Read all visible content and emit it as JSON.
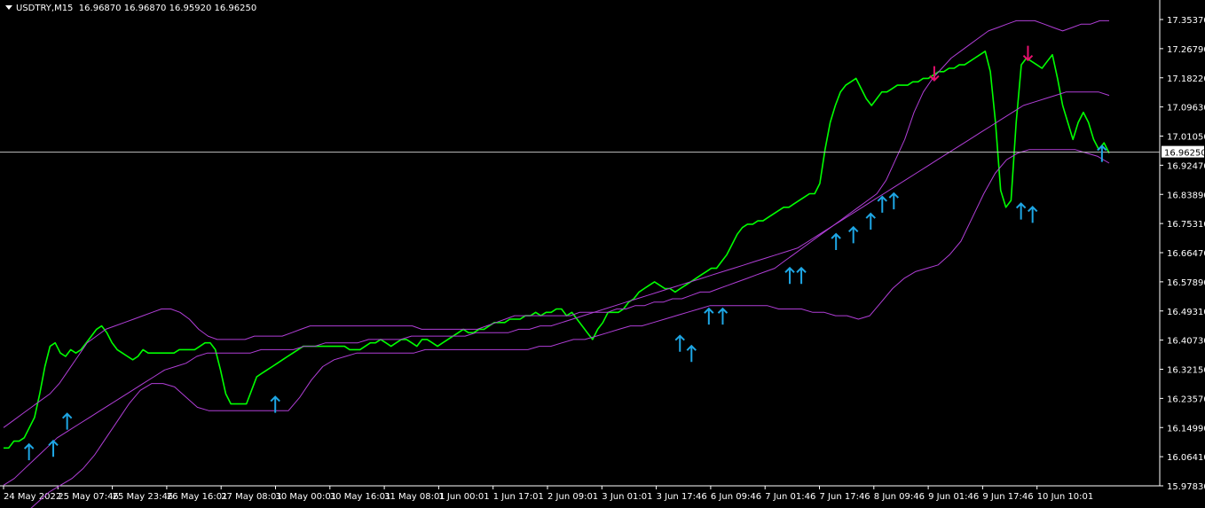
{
  "header": {
    "symbol_tf": "USDTRY,M15",
    "open": "16.96870",
    "high": "16.96870",
    "low": "16.95920",
    "close": "16.96250"
  },
  "chart_data": {
    "type": "line",
    "symbol": "USDTRY",
    "timeframe": "M15",
    "current_price": "16.96250",
    "y_axis_labels": [
      "17.35370",
      "17.26790",
      "17.18220",
      "17.09630",
      "17.01050",
      "16.92470",
      "16.83890",
      "16.75310",
      "16.66470",
      "16.57890",
      "16.49310",
      "16.40730",
      "16.32150",
      "16.23570",
      "16.14990",
      "16.06410",
      "15.97830"
    ],
    "y_range": [
      15.9783,
      17.3537
    ],
    "x_axis_labels": [
      "24 May 2022",
      "25 May 07:46",
      "25 May 23:46",
      "26 May 16:01",
      "27 May 08:01",
      "30 May 00:01",
      "30 May 16:01",
      "31 May 08:01",
      "1 Jun 00:01",
      "1 Jun 17:01",
      "2 Jun 09:01",
      "3 Jun 01:01",
      "3 Jun 17:46",
      "6 Jun 09:46",
      "7 Jun 01:46",
      "7 Jun 17:46",
      "8 Jun 09:46",
      "9 Jun 01:46",
      "9 Jun 17:46",
      "10 Jun 10:01"
    ],
    "series": [
      {
        "role": "price",
        "values": [
          16.09,
          16.09,
          16.11,
          16.11,
          16.12,
          16.15,
          16.18,
          16.25,
          16.33,
          16.39,
          16.4,
          16.37,
          16.36,
          16.38,
          16.37,
          16.38,
          16.4,
          16.42,
          16.44,
          16.45,
          16.43,
          16.4,
          16.38,
          16.37,
          16.36,
          16.35,
          16.36,
          16.38,
          16.37,
          16.37,
          16.37,
          16.37,
          16.37,
          16.37,
          16.38,
          16.38,
          16.38,
          16.38,
          16.39,
          16.4,
          16.4,
          16.38,
          16.32,
          16.25,
          16.22,
          16.22,
          16.22,
          16.22,
          16.26,
          16.3,
          16.31,
          16.32,
          16.33,
          16.34,
          16.35,
          16.36,
          16.37,
          16.38,
          16.39,
          16.39,
          16.39,
          16.39,
          16.39,
          16.39,
          16.39,
          16.39,
          16.39,
          16.38,
          16.38,
          16.38,
          16.39,
          16.4,
          16.4,
          16.41,
          16.4,
          16.39,
          16.4,
          16.41,
          16.41,
          16.4,
          16.39,
          16.41,
          16.41,
          16.4,
          16.39,
          16.4,
          16.41,
          16.42,
          16.43,
          16.44,
          16.43,
          16.43,
          16.44,
          16.44,
          16.45,
          16.46,
          16.46,
          16.46,
          16.47,
          16.47,
          16.47,
          16.48,
          16.48,
          16.49,
          16.48,
          16.49,
          16.49,
          16.5,
          16.5,
          16.48,
          16.49,
          16.47,
          16.45,
          16.43,
          16.41,
          16.44,
          16.46,
          16.49,
          16.49,
          16.49,
          16.5,
          16.52,
          16.53,
          16.55,
          16.56,
          16.57,
          16.58,
          16.57,
          16.56,
          16.56,
          16.55,
          16.56,
          16.57,
          16.58,
          16.59,
          16.6,
          16.61,
          16.62,
          16.62,
          16.64,
          16.66,
          16.69,
          16.72,
          16.74,
          16.75,
          16.75,
          16.76,
          16.76,
          16.77,
          16.78,
          16.79,
          16.8,
          16.8,
          16.81,
          16.82,
          16.83,
          16.84,
          16.84,
          16.87,
          16.97,
          17.05,
          17.1,
          17.14,
          17.16,
          17.17,
          17.18,
          17.15,
          17.12,
          17.1,
          17.12,
          17.14,
          17.14,
          17.15,
          17.16,
          17.16,
          17.16,
          17.17,
          17.17,
          17.18,
          17.18,
          17.19,
          17.2,
          17.2,
          17.21,
          17.21,
          17.22,
          17.22,
          17.23,
          17.24,
          17.25,
          17.26,
          17.2,
          17.05,
          16.85,
          16.8,
          16.82,
          17.05,
          17.22,
          17.24,
          17.23,
          17.22,
          17.21,
          17.23,
          17.25,
          17.18,
          17.1,
          17.05,
          17.0,
          17.05,
          17.08,
          17.05,
          17.0,
          16.97,
          16.99,
          16.96
        ],
        "color": "#00ff00"
      },
      {
        "role": "upper_band",
        "values": [
          16.15,
          16.17,
          16.19,
          16.21,
          16.23,
          16.25,
          16.28,
          16.32,
          16.36,
          16.4,
          16.42,
          16.44,
          16.45,
          16.46,
          16.47,
          16.48,
          16.49,
          16.5,
          16.5,
          16.49,
          16.47,
          16.44,
          16.42,
          16.41,
          16.41,
          16.41,
          16.41,
          16.42,
          16.42,
          16.42,
          16.42,
          16.43,
          16.44,
          16.45,
          16.45,
          16.45,
          16.45,
          16.45,
          16.45,
          16.45,
          16.45,
          16.45,
          16.45,
          16.45,
          16.45,
          16.44,
          16.44,
          16.44,
          16.44,
          16.44,
          16.44,
          16.44,
          16.45,
          16.46,
          16.47,
          16.48,
          16.48,
          16.48,
          16.48,
          16.48,
          16.48,
          16.48,
          16.49,
          16.49,
          16.49,
          16.49,
          16.5,
          16.5,
          16.51,
          16.51,
          16.52,
          16.52,
          16.53,
          16.53,
          16.54,
          16.55,
          16.55,
          16.56,
          16.57,
          16.58,
          16.59,
          16.6,
          16.61,
          16.62,
          16.64,
          16.66,
          16.68,
          16.7,
          16.72,
          16.74,
          16.76,
          16.78,
          16.8,
          16.82,
          16.84,
          16.88,
          16.94,
          17.0,
          17.08,
          17.14,
          17.18,
          17.21,
          17.24,
          17.26,
          17.28,
          17.3,
          17.32,
          17.33,
          17.34,
          17.35,
          17.35,
          17.35,
          17.34,
          17.33,
          17.32,
          17.33,
          17.34,
          17.34,
          17.35,
          17.35
        ],
        "color": "#b03ed6"
      },
      {
        "role": "middle_band",
        "values": [
          15.98,
          16.0,
          16.03,
          16.06,
          16.09,
          16.12,
          16.14,
          16.16,
          16.18,
          16.2,
          16.22,
          16.24,
          16.26,
          16.28,
          16.3,
          16.32,
          16.33,
          16.34,
          16.36,
          16.37,
          16.37,
          16.37,
          16.37,
          16.37,
          16.38,
          16.38,
          16.38,
          16.38,
          16.39,
          16.39,
          16.4,
          16.4,
          16.4,
          16.4,
          16.41,
          16.41,
          16.41,
          16.41,
          16.42,
          16.42,
          16.42,
          16.42,
          16.42,
          16.42,
          16.43,
          16.43,
          16.43,
          16.43,
          16.44,
          16.44,
          16.45,
          16.45,
          16.46,
          16.47,
          16.48,
          16.49,
          16.5,
          16.51,
          16.52,
          16.53,
          16.54,
          16.55,
          16.56,
          16.57,
          16.58,
          16.59,
          16.6,
          16.61,
          16.62,
          16.63,
          16.64,
          16.65,
          16.66,
          16.67,
          16.68,
          16.7,
          16.72,
          16.74,
          16.76,
          16.78,
          16.8,
          16.82,
          16.84,
          16.86,
          16.88,
          16.9,
          16.92,
          16.94,
          16.96,
          16.98,
          17.0,
          17.02,
          17.04,
          17.06,
          17.08,
          17.1,
          17.11,
          17.12,
          17.13,
          17.14,
          17.14,
          17.14,
          17.14,
          17.13
        ],
        "color": "#b03ed6"
      },
      {
        "role": "lower_band",
        "values": [
          15.85,
          15.87,
          15.9,
          15.93,
          15.96,
          15.98,
          16.0,
          16.03,
          16.07,
          16.12,
          16.17,
          16.22,
          16.26,
          16.28,
          16.28,
          16.27,
          16.24,
          16.21,
          16.2,
          16.2,
          16.2,
          16.2,
          16.2,
          16.2,
          16.2,
          16.2,
          16.24,
          16.29,
          16.33,
          16.35,
          16.36,
          16.37,
          16.37,
          16.37,
          16.37,
          16.37,
          16.37,
          16.38,
          16.38,
          16.38,
          16.38,
          16.38,
          16.38,
          16.38,
          16.38,
          16.38,
          16.38,
          16.39,
          16.39,
          16.4,
          16.41,
          16.41,
          16.42,
          16.43,
          16.44,
          16.45,
          16.45,
          16.46,
          16.47,
          16.48,
          16.49,
          16.5,
          16.51,
          16.51,
          16.51,
          16.51,
          16.51,
          16.51,
          16.5,
          16.5,
          16.5,
          16.49,
          16.49,
          16.48,
          16.48,
          16.47,
          16.48,
          16.52,
          16.56,
          16.59,
          16.61,
          16.62,
          16.63,
          16.66,
          16.7,
          16.77,
          16.84,
          16.9,
          16.94,
          16.96,
          16.97,
          16.97,
          16.97,
          16.97,
          16.97,
          16.96,
          16.95,
          16.93
        ],
        "color": "#b03ed6"
      }
    ],
    "buy_arrows": [
      [
        0.022,
        16.08
      ],
      [
        0.043,
        16.09
      ],
      [
        0.055,
        16.17
      ],
      [
        0.235,
        16.22
      ],
      [
        0.585,
        16.4
      ],
      [
        0.595,
        16.37
      ],
      [
        0.61,
        16.48
      ],
      [
        0.622,
        16.48
      ],
      [
        0.68,
        16.6
      ],
      [
        0.69,
        16.6
      ],
      [
        0.72,
        16.7
      ],
      [
        0.735,
        16.72
      ],
      [
        0.75,
        16.76
      ],
      [
        0.76,
        16.81
      ],
      [
        0.77,
        16.82
      ],
      [
        0.88,
        16.79
      ],
      [
        0.89,
        16.78
      ],
      [
        0.95,
        16.96
      ]
    ],
    "sell_arrows": [
      [
        0.805,
        17.19
      ],
      [
        0.886,
        17.25
      ]
    ],
    "buy_arrow_color": "#1ea6e4",
    "sell_arrow_color": "#e6106e",
    "axis_color": "#ffffff",
    "grid": false
  }
}
